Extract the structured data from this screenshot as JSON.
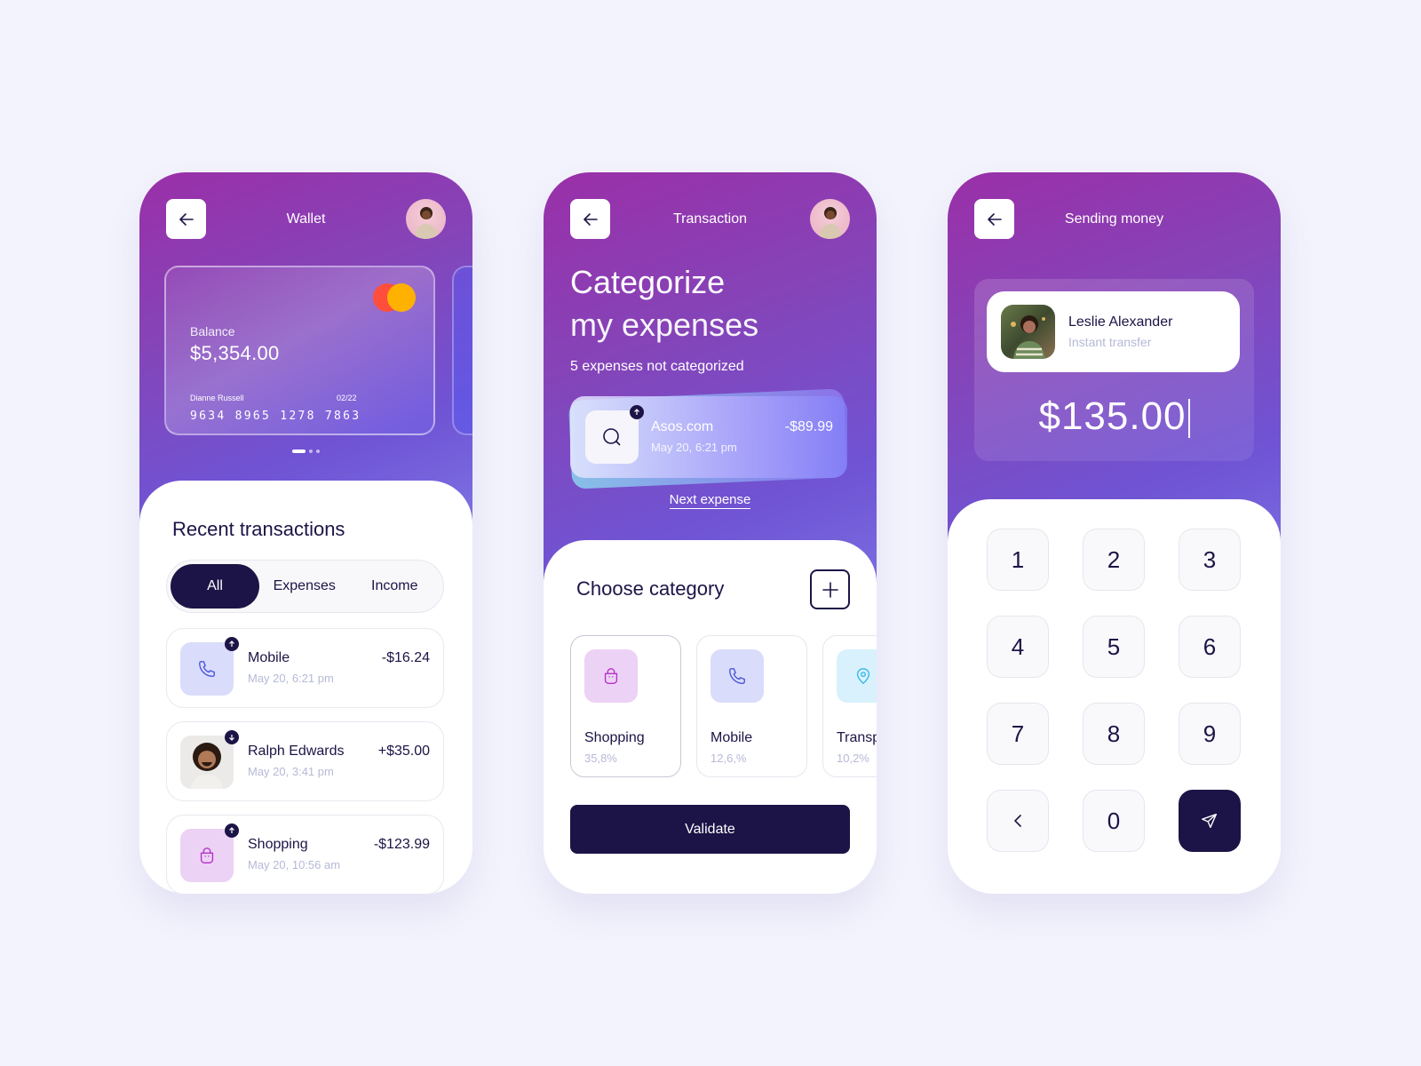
{
  "colors": {
    "background": "#f3f3fd",
    "primary_dark": "#1c1446",
    "muted_text": "#b6b9d6",
    "mastercard_red": "#ff4f3c",
    "mastercard_yellow": "#ffb100",
    "shopping_tint": "#ecd2f5",
    "mobile_tint": "#dadcfb",
    "transport_tint": "#d9f1fd"
  },
  "wallet": {
    "title": "Wallet",
    "back_icon": "arrow-left-icon",
    "card": {
      "balance_label": "Balance",
      "balance": "$5,354.00",
      "holder": "Dianne Russell",
      "expiry": "02/22",
      "number": "9634 8965 1278 7863",
      "brand_icon": "mastercard-icon"
    },
    "carousel": {
      "count": 3,
      "active_index": 0
    },
    "recent_title": "Recent transactions",
    "filters": [
      {
        "label": "All",
        "active": true
      },
      {
        "label": "Expenses",
        "active": false
      },
      {
        "label": "Income",
        "active": false
      }
    ],
    "transactions": [
      {
        "name": "Mobile",
        "date": "May 20, 6:21 pm",
        "amount": "-$16.24",
        "icon": "phone-icon",
        "direction": "up"
      },
      {
        "name": "Ralph Edwards",
        "date": "May 20, 3:41 pm",
        "amount": "+$35.00",
        "icon": "avatar",
        "direction": "down"
      },
      {
        "name": "Shopping",
        "date": "May 20, 10:56 am",
        "amount": "-$123.99",
        "icon": "shopping-bag-icon",
        "direction": "up"
      }
    ]
  },
  "transaction": {
    "title": "Transaction",
    "heading_line1": "Categorize",
    "heading_line2": "my expenses",
    "subtitle": "5 expenses not categorized",
    "expense": {
      "name": "Asos.com",
      "date": "May 20, 6:21 pm",
      "amount": "-$89.99",
      "icon": "search-icon"
    },
    "next_link": "Next expense",
    "choose_title": "Choose category",
    "categories": [
      {
        "name": "Shopping",
        "percent": "35,8%",
        "icon": "shopping-bag-icon",
        "selected": true
      },
      {
        "name": "Mobile",
        "percent": "12,6,%",
        "icon": "phone-icon",
        "selected": false
      },
      {
        "name": "Transport",
        "percent": "10,2%",
        "icon": "location-pin-icon",
        "selected": false
      }
    ],
    "validate_label": "Validate"
  },
  "sending": {
    "title": "Sending money",
    "recipient": {
      "name": "Leslie Alexander",
      "subtitle": "Instant transfer"
    },
    "amount": "$135.00",
    "keys": [
      "1",
      "2",
      "3",
      "4",
      "5",
      "6",
      "7",
      "8",
      "9",
      "<",
      "0",
      "send"
    ]
  }
}
